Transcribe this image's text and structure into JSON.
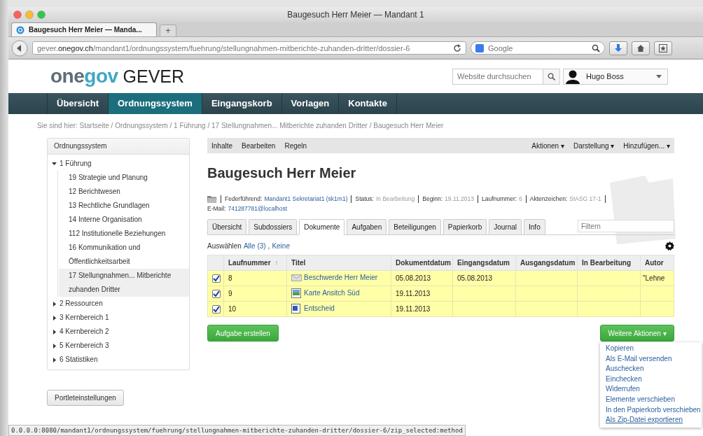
{
  "window": {
    "title": "Baugesuch Herr Meier — Mandant 1"
  },
  "browser": {
    "tabs": [
      {
        "label": "Baugesuch Herr Meier — Manda...",
        "selected": true
      }
    ],
    "new_tab": "+",
    "address": {
      "host_pre": "gever.",
      "host": "onegov.ch",
      "path": "/mandant1/ordnungssystem/fuehrung/stellungnahmen-mitberichte-zuhanden-dritter/dossier-6"
    },
    "search": {
      "placeholder": "Google"
    }
  },
  "header": {
    "logo": [
      {
        "text": "one",
        "kind": "dark"
      },
      {
        "text": "gov",
        "kind": "accent"
      },
      {
        "text": " GEVER",
        "kind": "plain"
      }
    ],
    "search": {
      "placeholder": "Website durchsuchen"
    },
    "user": {
      "name": "Hugo Boss"
    }
  },
  "nav": [
    {
      "label": "Übersicht",
      "selected": false
    },
    {
      "label": "Ordnungssystem",
      "selected": true
    },
    {
      "label": "Eingangskorb",
      "selected": false
    },
    {
      "label": "Vorlagen",
      "selected": false
    },
    {
      "label": "Kontakte",
      "selected": false
    }
  ],
  "breadcrumb": "Sie sind hier: Startseite / Ordnungssystem / 1 Führung / 17 Stellungnahmen... Mitberichte zuhanden Dritter / Baugesuch Herr Meier",
  "sidebar": {
    "title": "Ordnungssystem",
    "tree": [
      {
        "label": "1 Führung",
        "expanded": true,
        "selected": false,
        "children": [
          {
            "label": "19 Strategie und Planung",
            "selected": false
          },
          {
            "label": "12 Berichtwesen",
            "selected": false
          },
          {
            "label": "13 Rechtliche Grundlagen",
            "selected": false
          },
          {
            "label": "14 Interne Organisation",
            "selected": false
          },
          {
            "label": "112 Institutionelle Beziehungen",
            "selected": false
          },
          {
            "label": "16 Kommunikation und Öffentlichkeitsarbeit",
            "selected": false
          },
          {
            "label": "17 Stellungnahmen... Mitberichte zuhanden Dritter",
            "selected": true
          }
        ]
      },
      {
        "label": "2 Ressourcen",
        "expanded": false,
        "selected": false
      },
      {
        "label": "3 Kernbereich 1",
        "expanded": false,
        "selected": false
      },
      {
        "label": "4 Kernbereich 2",
        "expanded": false,
        "selected": false
      },
      {
        "label": "5 Kernbereich 3",
        "expanded": false,
        "selected": false
      },
      {
        "label": "6 Statistiken",
        "expanded": false,
        "selected": false
      }
    ],
    "settings_button": "Portleteinstellungen"
  },
  "toolbar": {
    "left": [
      "Inhalte",
      "Bearbeiten",
      "Regeln"
    ],
    "menus": [
      "Aktionen ▾",
      "Darstellung ▾",
      "Hinzufügen... ▾"
    ]
  },
  "title": "Baugesuch Herr Meier",
  "meta": [
    {
      "label": "Federführend:",
      "value": "Mandant1 Sekretariat1 (sk1m1)",
      "kind": "link"
    },
    {
      "label": "Status:",
      "value": "In Bearbeitung",
      "kind": "plain"
    },
    {
      "label": "Beginn:",
      "value": "19.11.2013",
      "kind": "plain"
    },
    {
      "label": "Laufnummer:",
      "value": "6",
      "kind": "plain"
    },
    {
      "label": "Aktenzeichen:",
      "value": "StASG 17-1",
      "kind": "plain"
    }
  ],
  "email": {
    "label": "E-Mail:",
    "value": "741287781@localhost"
  },
  "tabs": [
    {
      "label": "Übersicht",
      "selected": false
    },
    {
      "label": "Subdossiers",
      "selected": false
    },
    {
      "label": "Dokumente",
      "selected": true
    },
    {
      "label": "Aufgaben",
      "selected": false
    },
    {
      "label": "Beteiligungen",
      "selected": false
    },
    {
      "label": "Papierkorb",
      "selected": false
    },
    {
      "label": "Journal",
      "selected": false
    },
    {
      "label": "Info",
      "selected": false
    }
  ],
  "filter": {
    "placeholder": "Filtern"
  },
  "select": {
    "label": "Auswählen",
    "all": "Alle (3)",
    "separator": ",",
    "none": "Keine"
  },
  "table": {
    "columns": [
      {
        "label": "Laufnummer",
        "sort": "↑"
      },
      {
        "label": "Titel"
      },
      {
        "label": "Dokumentdatum"
      },
      {
        "label": "Eingangsdatum"
      },
      {
        "label": "Ausgangsdatum"
      },
      {
        "label": "In Bearbeitung"
      },
      {
        "label": "Autor"
      }
    ],
    "rows": [
      {
        "checked": true,
        "kind": "mail",
        "cells": [
          "8",
          "Beschwerde Herr Meier",
          "05.08.2013",
          "05.08.2013",
          "",
          "",
          "\"Lehne"
        ]
      },
      {
        "checked": true,
        "kind": "image",
        "cells": [
          "9",
          "Karte Ansitch Süd",
          "19.11.2013",
          "",
          "",
          "",
          ""
        ]
      },
      {
        "checked": true,
        "kind": "word",
        "cells": [
          "10",
          "Entscheid",
          "19.11.2013",
          "",
          "",
          "",
          ""
        ]
      }
    ]
  },
  "create_task_button": "Aufgabe erstellen",
  "more_actions": {
    "label": "Weitere Aktionen ▾",
    "expanded": true,
    "items": [
      {
        "label": "Kopieren",
        "selected": false
      },
      {
        "label": "Als E-Mail versenden",
        "selected": false
      },
      {
        "label": "Auschecken",
        "selected": false
      },
      {
        "label": "Einchecken",
        "selected": false
      },
      {
        "label": "Widerrufen",
        "selected": false
      },
      {
        "label": "Elemente verschieben",
        "selected": false
      },
      {
        "label": "In den Papierkorb verschieben",
        "selected": false
      },
      {
        "label": "Als Zip-Datei exportieren",
        "selected": true
      }
    ]
  },
  "status_bar": "0.0.0.0:8080/mandant1/ordnungssystem/fuehrung/stellungnahmen-mitberichte-zuhanden-dritter/dossier-6/zip_selected:method"
}
